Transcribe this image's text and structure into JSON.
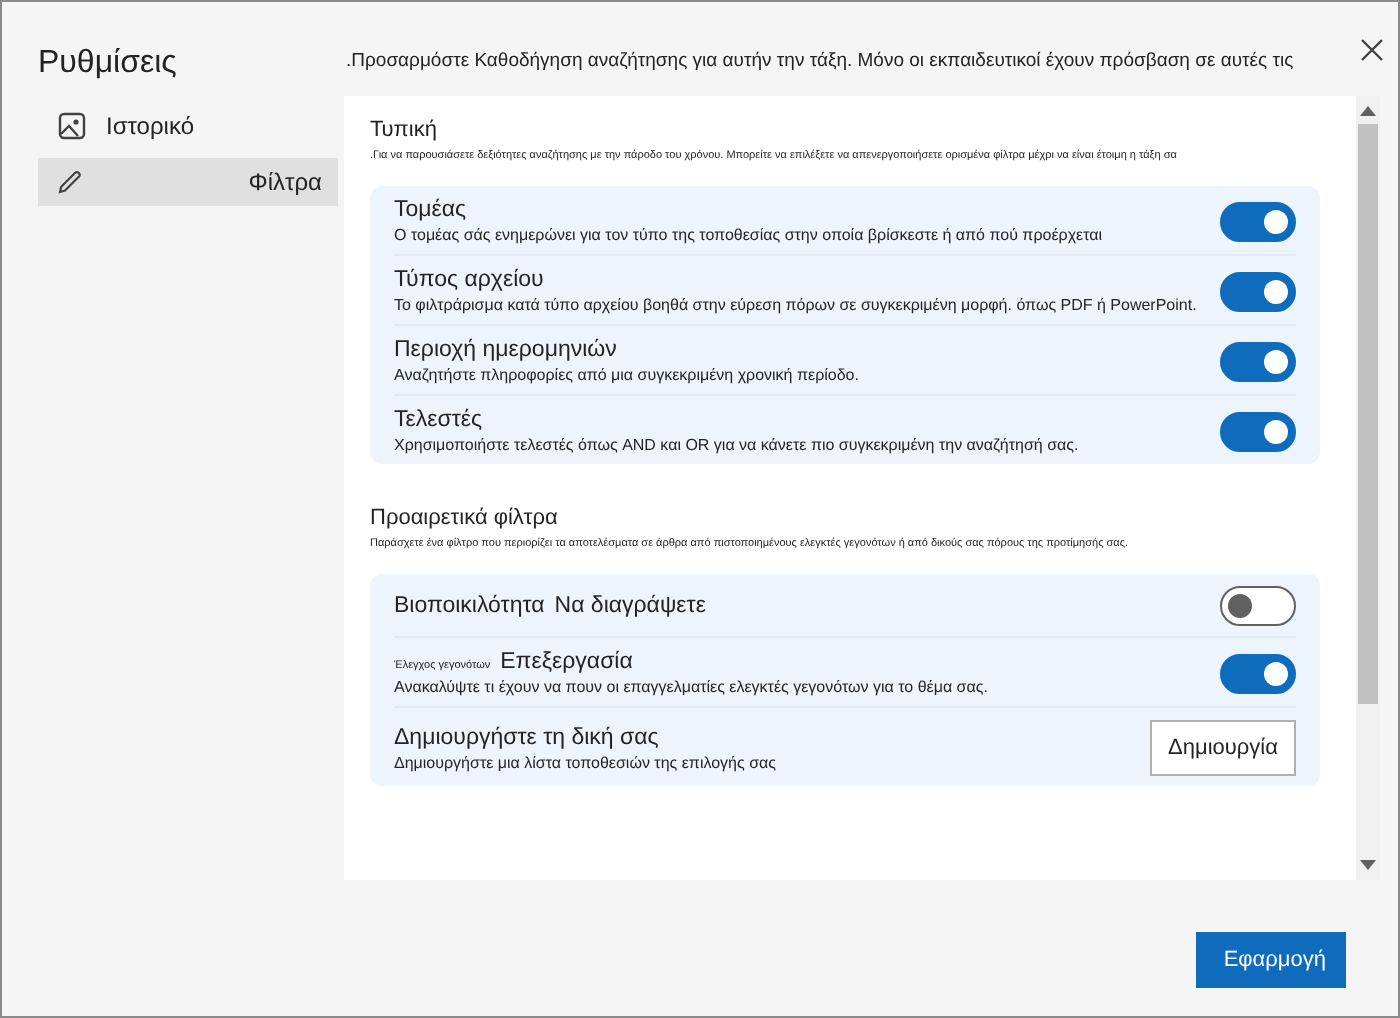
{
  "sidebar": {
    "title": "Ρυθμίσεις",
    "items": [
      {
        "label": "Ιστορικό",
        "selected": false
      },
      {
        "label": "Φίλτρα",
        "selected": true
      }
    ]
  },
  "header_text": ".Προσαρμόστε Καθοδήγηση αναζήτησης για αυτήν την τάξη. Μόνο οι εκπαιδευτικοί έχουν πρόσβαση σε αυτές τις",
  "sections": [
    {
      "title": "Τυπική",
      "note": ".Για να παρουσιάσετε δεξιότητες αναζήτησης με την πάροδο του χρόνου. Μπορείτε να επιλέξετε να απενεργοποιήσετε ορισμένα φίλτρα μέχρι να είναι έτοιμη η τάξη σα",
      "items": [
        {
          "kind": "toggle",
          "title": "Τομέας",
          "description": "Ο τομέας σάς ενημερώνει για τον τύπο της τοποθεσίας στην οποία βρίσκεστε ή από πού προέρχεται",
          "on": true
        },
        {
          "kind": "toggle",
          "title": "Τύπος αρχείου",
          "description": "Το φιλτράρισμα κατά τύπο αρχείου βοηθά στην εύρεση πόρων σε συγκεκριμένη μορφή. όπως PDF ή PowerPoint.",
          "on": true
        },
        {
          "kind": "toggle",
          "title": "Περιοχή ημερομηνιών",
          "description": "Αναζητήστε πληροφορίες από μια συγκεκριμένη χρονική περίοδο.",
          "on": true
        },
        {
          "kind": "toggle",
          "title": "Τελεστές",
          "description": "Χρησιμοποιήστε τελεστές όπως AND και OR για να κάνετε πιο συγκεκριμένη την αναζήτησή σας.",
          "on": true
        }
      ]
    },
    {
      "title": "Προαιρετικά φίλτρα",
      "note": "Παράσχετε ένα φίλτρο που περιορίζει τα αποτελέσματα σε άρθρα από πιστοποιημένους ελεγκτές γεγονότων ή από δικούς σας πόρους της προτίμησής σας.",
      "items": [
        {
          "kind": "toggle",
          "title": "Βιοποικιλότητα",
          "suffix": "Να διαγράψετε",
          "on": false
        },
        {
          "kind": "toggle",
          "prefix": "Έλεγχος γεγονότων",
          "title": "Επεξεργασία",
          "description": "Ανακαλύψτε τι έχουν να πουν οι επαγγελματίες ελεγκτές γεγονότων για το θέμα σας.",
          "on": true
        },
        {
          "kind": "button",
          "title": "Δημιουργήστε τη δική σας",
          "description": "Δημιουργήστε μια λίστα τοποθεσιών της επιλογής σας",
          "button": "Δημιουργία"
        }
      ]
    }
  ],
  "apply_button": "Εφαρμογή"
}
